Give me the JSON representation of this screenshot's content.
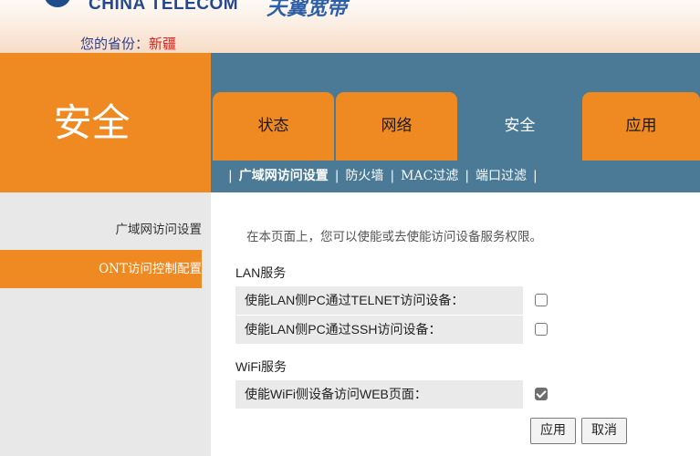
{
  "header": {
    "brand_en": "CHINA TELECOM",
    "brand_cn": "天翼宽带",
    "province_label": "您的省份：",
    "province_value": "新疆"
  },
  "section_title": "安全",
  "tabs": [
    {
      "label": "状态",
      "active": false
    },
    {
      "label": "网络",
      "active": false
    },
    {
      "label": "安全",
      "active": true
    },
    {
      "label": "应用",
      "active": false
    }
  ],
  "subnav": {
    "separator": "|",
    "items": [
      "广域网访问设置",
      "防火墙",
      "MAC过滤",
      "端口过滤"
    ],
    "current_index": 0
  },
  "sidebar": {
    "items": [
      "广域网访问设置",
      "ONT访问控制配置"
    ],
    "active_index": 1
  },
  "content": {
    "intro": "在本页面上，您可以使能或去使能访问设备服务权限。",
    "lan_title": "LAN服务",
    "telnet_label": "使能LAN侧PC通过TELNET访问设备：",
    "telnet_checked": false,
    "ssh_label": "使能LAN侧PC通过SSH访问设备：",
    "ssh_checked": false,
    "wifi_title": "WiFi服务",
    "wifi_label": "使能WiFi侧设备访问WEB页面：",
    "wifi_checked": true
  },
  "buttons": {
    "apply": "应用",
    "cancel": "取消"
  },
  "colors": {
    "orange": "#ef8a23",
    "steel_blue": "#4a7a96",
    "brand_blue": "#25488a",
    "province_red": "#e11b1b"
  }
}
